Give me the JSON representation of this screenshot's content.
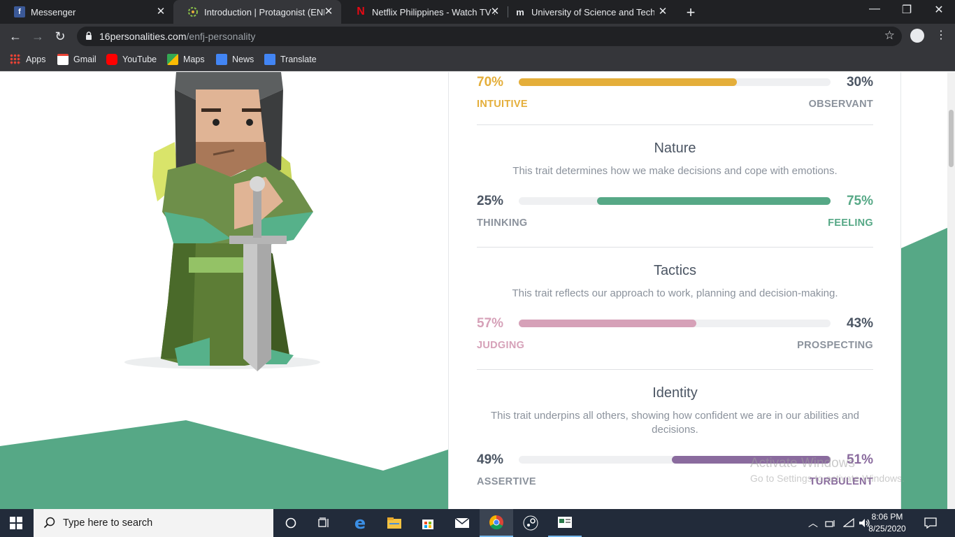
{
  "browser": {
    "tabs": [
      {
        "title": "Messenger",
        "icon": "facebook-icon",
        "active": false
      },
      {
        "title": "Introduction | Protagonist (ENFJ)",
        "icon": "16personalities-icon",
        "active": true
      },
      {
        "title": "Netflix Philippines - Watch TV Sh",
        "icon": "netflix-icon",
        "active": false
      },
      {
        "title": "University of Science and Techno",
        "icon": "moodle-icon",
        "active": false
      }
    ],
    "url_domain": "16personalities.com",
    "url_path": "/enfj-personality",
    "bookmarks": [
      {
        "label": "Apps",
        "icon": "apps-grid-icon"
      },
      {
        "label": "Gmail",
        "icon": "gmail-icon"
      },
      {
        "label": "YouTube",
        "icon": "youtube-icon"
      },
      {
        "label": "Maps",
        "icon": "maps-icon"
      },
      {
        "label": "News",
        "icon": "news-icon"
      },
      {
        "label": "Translate",
        "icon": "translate-icon"
      }
    ]
  },
  "traits": {
    "energy": {
      "left_pct": "70%",
      "right_pct": "30%",
      "left_label": "INTUITIVE",
      "right_label": "OBSERVANT",
      "fill_fraction": 0.7,
      "fill_side": "left",
      "color": "#e4ae3a"
    },
    "nature": {
      "title": "Nature",
      "desc": "This trait determines how we make decisions and cope with emotions.",
      "left_pct": "25%",
      "right_pct": "75%",
      "left_label": "THINKING",
      "right_label": "FEELING",
      "fill_fraction": 0.75,
      "fill_side": "right",
      "color": "#56a886"
    },
    "tactics": {
      "title": "Tactics",
      "desc": "This trait reflects our approach to work, planning and decision-making.",
      "left_pct": "57%",
      "right_pct": "43%",
      "left_label": "JUDGING",
      "right_label": "PROSPECTING",
      "fill_fraction": 0.57,
      "fill_side": "left",
      "color": "#d6a1b8"
    },
    "identity": {
      "title": "Identity",
      "desc": "This trait underpins all others, showing how confident we are in our abilities and decisions.",
      "left_pct": "49%",
      "right_pct": "51%",
      "left_label": "ASSERTIVE",
      "right_label": "TURBULENT",
      "fill_fraction": 0.51,
      "fill_side": "right",
      "color": "#8a6b9e"
    }
  },
  "watermark": {
    "line1": "Activate Windows",
    "line2": "Go to Settings to activate Windows."
  },
  "taskbar": {
    "search_placeholder": "Type here to search",
    "time": "8:06 PM",
    "date": "8/25/2020"
  },
  "colors": {
    "accent_green": "#56a886",
    "taskbar": "#222b3a",
    "chrome_dark": "#202124"
  }
}
